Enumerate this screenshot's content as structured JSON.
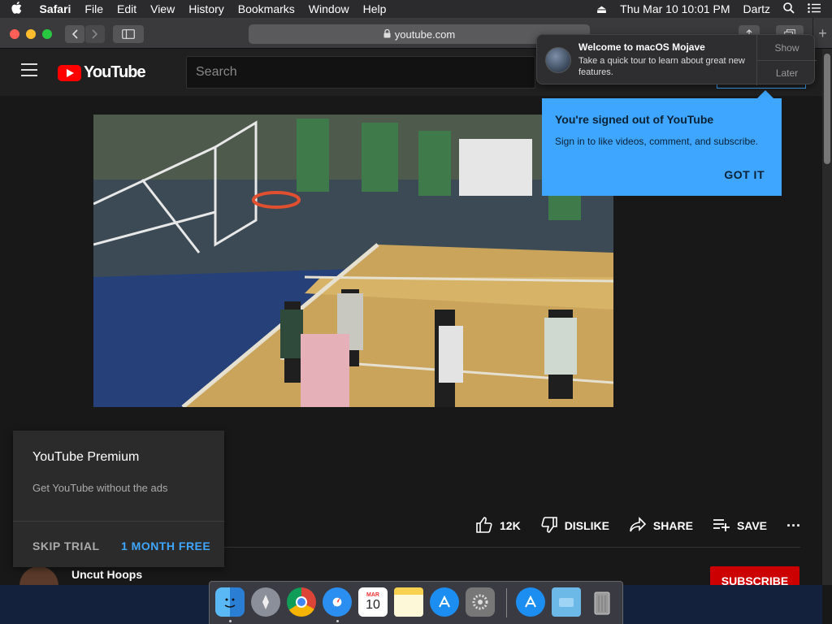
{
  "menubar": {
    "apple": "",
    "items": [
      "Safari",
      "File",
      "Edit",
      "View",
      "History",
      "Bookmarks",
      "Window",
      "Help"
    ],
    "datetime": "Thu Mar 10  10:01 PM",
    "user": "Dartz"
  },
  "safari": {
    "url": "youtube.com",
    "new_tab": "+"
  },
  "youtube": {
    "logo_text": "YouTube",
    "search_placeholder": "Search",
    "actions": {
      "likes": "12K",
      "dislike": "DISLIKE",
      "share": "SHARE",
      "save": "SAVE",
      "more": "···"
    },
    "channel": {
      "name": "Uncut Hoops"
    },
    "subscribe": "SUBSCRIBE"
  },
  "premium_popup": {
    "title": "YouTube Premium",
    "description": "Get YouTube without the ads",
    "skip": "SKIP TRIAL",
    "free": "1 MONTH FREE"
  },
  "signin_tooltip": {
    "title": "You're signed out of YouTube",
    "description": "Sign in to like videos, comment, and subscribe.",
    "button": "GOT IT"
  },
  "notification": {
    "title": "Welcome to macOS Mojave",
    "body": "Take a quick tour to learn about great new features.",
    "show": "Show",
    "later": "Later"
  },
  "dock": {
    "calendar_month": "MAR",
    "calendar_day": "10",
    "apps": [
      "finder-icon",
      "launchpad-icon",
      "chrome-icon",
      "safari-icon",
      "calendar-icon",
      "notes-icon",
      "app-store-icon",
      "system-preferences-icon",
      "downloads-icon",
      "folder-icon",
      "trash-icon"
    ]
  },
  "colors": {
    "yt_background": "#181818",
    "yt_header": "#202020",
    "accent_blue": "#3ea6ff",
    "yt_red": "#ff0000",
    "subscribe_red": "#cc0000"
  }
}
